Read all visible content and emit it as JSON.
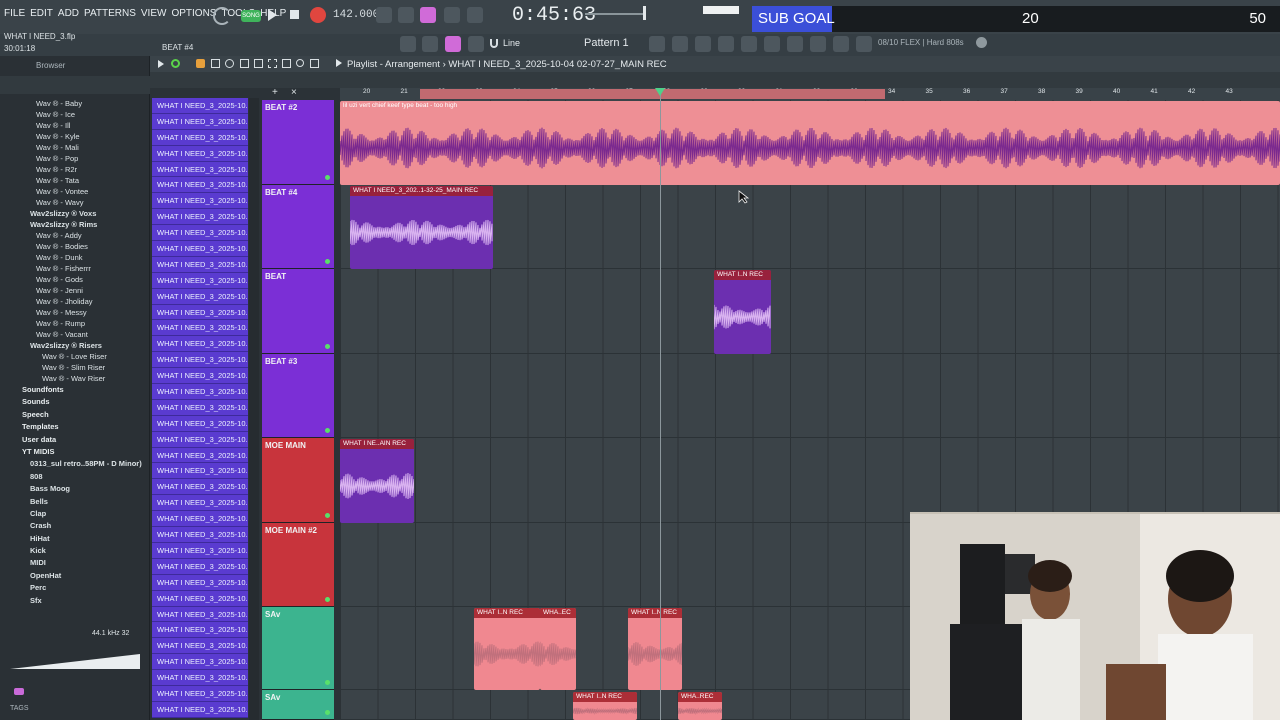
{
  "menu": [
    "FILE",
    "EDIT",
    "ADD",
    "PATTERNS",
    "VIEW",
    "OPTIONS",
    "TOOLS",
    "HELP"
  ],
  "transport": {
    "song_label": "SONG",
    "tempo": "142.000",
    "time": "0:45:63"
  },
  "sub_goal": {
    "label": "SUB GOAL",
    "current": "20",
    "target": "50",
    "progress": 0.4
  },
  "project": {
    "file": "WHAT I NEED_3.flp",
    "elapsed": "30:01:18",
    "current_pattern_label": "BEAT #4"
  },
  "toolbar": {
    "pattern": "Pattern 1",
    "snap": "Line",
    "hint": "08/10  FLEX | Hard 808s"
  },
  "browser": {
    "title": "Browser",
    "items": [
      {
        "t": "Wav ® - Baby",
        "k": "l1"
      },
      {
        "t": "Wav ® - Ice",
        "k": "l1"
      },
      {
        "t": "Wav ® - Ill",
        "k": "l1"
      },
      {
        "t": "Wav ® - Kyle",
        "k": "l1"
      },
      {
        "t": "Wav ® - Mali",
        "k": "l1"
      },
      {
        "t": "Wav ® - Pop",
        "k": "l1"
      },
      {
        "t": "Wav ® - R2r",
        "k": "l1"
      },
      {
        "t": "Wav ® - Tata",
        "k": "l1"
      },
      {
        "t": "Wav ® - Vontee",
        "k": "l1"
      },
      {
        "t": "Wav ® - Wavy",
        "k": "l1"
      },
      {
        "t": "Wav2slizzy ® Voxs",
        "k": "fold"
      },
      {
        "t": "Wav2slizzy ® Rims",
        "k": "fold"
      },
      {
        "t": "Wav ® - Addy",
        "k": "l1"
      },
      {
        "t": "Wav ® - Bodies",
        "k": "l1"
      },
      {
        "t": "Wav ® - Dunk",
        "k": "l1"
      },
      {
        "t": "Wav ® - Fisherrr",
        "k": "l1"
      },
      {
        "t": "Wav ® - Gods",
        "k": "l1"
      },
      {
        "t": "Wav ® - Jenni",
        "k": "l1"
      },
      {
        "t": "Wav ® - Jholiday",
        "k": "l1"
      },
      {
        "t": "Wav ® - Messy",
        "k": "l1"
      },
      {
        "t": "Wav ® - Rump",
        "k": "l1"
      },
      {
        "t": "Wav ® - Vacant",
        "k": "l1"
      },
      {
        "t": "Wav2slizzy ® Risers",
        "k": "fold"
      },
      {
        "t": "Wav ® - Love Riser",
        "k": "l1b"
      },
      {
        "t": "Wav ® - Slim Riser",
        "k": "l1b"
      },
      {
        "t": "Wav ® - Wav Riser",
        "k": "l1b"
      },
      {
        "t": "Soundfonts",
        "k": "f"
      },
      {
        "t": "Sounds",
        "k": "f"
      },
      {
        "t": "Speech",
        "k": "f"
      },
      {
        "t": "Templates",
        "k": "f"
      },
      {
        "t": "User data",
        "k": "f"
      },
      {
        "t": "YT MIDIS",
        "k": "f"
      },
      {
        "t": "0313_sul retro..58PM - D Minor)",
        "k": "f2"
      },
      {
        "t": "808",
        "k": "f2"
      },
      {
        "t": "Bass Moog",
        "k": "f2"
      },
      {
        "t": "Bells",
        "k": "f2"
      },
      {
        "t": "Clap",
        "k": "f2"
      },
      {
        "t": "Crash",
        "k": "f2"
      },
      {
        "t": "HiHat",
        "k": "f2"
      },
      {
        "t": "Kick",
        "k": "f2"
      },
      {
        "t": "MIDI",
        "k": "f2"
      },
      {
        "t": "OpenHat",
        "k": "f2"
      },
      {
        "t": "Perc",
        "k": "f2"
      },
      {
        "t": "Sfx",
        "k": "f2"
      }
    ],
    "audio_info": "44.1 kHz 32",
    "tags_label": "TAGS"
  },
  "playlist": {
    "title": "Playlist - Arrangement",
    "clip_name": "WHAT I NEED_3_2025-10-04 02-07-27_MAIN REC",
    "pattern_entry": "WHAT I NEED_3_2025-10...",
    "ruler_ticks": [
      "20",
      "21",
      "22",
      "23",
      "24",
      "25",
      "26",
      "27",
      "28",
      "29",
      "30",
      "31",
      "32",
      "33",
      "34",
      "35",
      "36",
      "37",
      "38",
      "39",
      "40",
      "41",
      "42",
      "43"
    ],
    "tracks": [
      {
        "name": "BEAT #2",
        "color": "#7b2fd6"
      },
      {
        "name": "BEAT #4",
        "color": "#7b2fd6"
      },
      {
        "name": "BEAT",
        "color": "#7b2fd6"
      },
      {
        "name": "BEAT #3",
        "color": "#7b2fd6"
      },
      {
        "name": "MOE MAIN",
        "color": "#c8343c"
      },
      {
        "name": "MOE MAIN #2",
        "color": "#c8343c"
      },
      {
        "name": "SAv",
        "color": "#3cb48f"
      },
      {
        "name": "SAv",
        "color": "#3cb48f"
      }
    ],
    "clips": [
      {
        "label": "lil uzi vert  chief keef type beat  - too high",
        "color": "#ee8f95"
      },
      {
        "label": "WHAT I NEED_3_202..1-32-25_MAIN REC",
        "color": "#6c2fb0"
      },
      {
        "label": "WHAT I..N REC",
        "color": "#6c2fb0"
      },
      {
        "label": "WHAT I NE..AIN REC",
        "color": "#6c2fb0"
      },
      {
        "label": "WHAT I..N REC",
        "color": "#f08890"
      },
      {
        "label": "WHA..EC",
        "color": "#f08890"
      },
      {
        "label": "WHAT I..N REC",
        "color": "#f08890"
      },
      {
        "label": "WHAT I..N REC",
        "color": "#f08890"
      },
      {
        "label": "WHA..REC",
        "color": "#f08890"
      }
    ]
  }
}
